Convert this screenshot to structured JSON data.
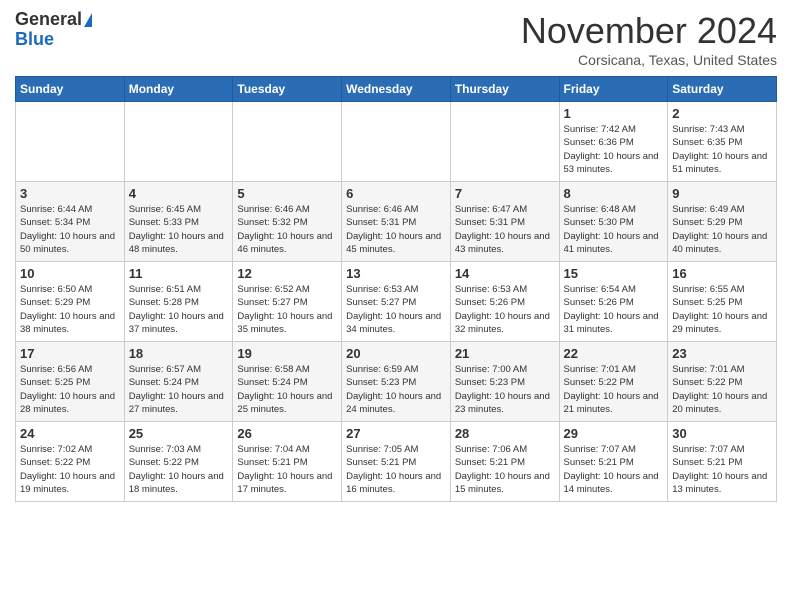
{
  "logo": {
    "general": "General",
    "blue": "Blue"
  },
  "header": {
    "month": "November 2024",
    "location": "Corsicana, Texas, United States"
  },
  "weekdays": [
    "Sunday",
    "Monday",
    "Tuesday",
    "Wednesday",
    "Thursday",
    "Friday",
    "Saturday"
  ],
  "weeks": [
    [
      {
        "day": "",
        "info": ""
      },
      {
        "day": "",
        "info": ""
      },
      {
        "day": "",
        "info": ""
      },
      {
        "day": "",
        "info": ""
      },
      {
        "day": "",
        "info": ""
      },
      {
        "day": "1",
        "info": "Sunrise: 7:42 AM\nSunset: 6:36 PM\nDaylight: 10 hours and 53 minutes."
      },
      {
        "day": "2",
        "info": "Sunrise: 7:43 AM\nSunset: 6:35 PM\nDaylight: 10 hours and 51 minutes."
      }
    ],
    [
      {
        "day": "3",
        "info": "Sunrise: 6:44 AM\nSunset: 5:34 PM\nDaylight: 10 hours and 50 minutes."
      },
      {
        "day": "4",
        "info": "Sunrise: 6:45 AM\nSunset: 5:33 PM\nDaylight: 10 hours and 48 minutes."
      },
      {
        "day": "5",
        "info": "Sunrise: 6:46 AM\nSunset: 5:32 PM\nDaylight: 10 hours and 46 minutes."
      },
      {
        "day": "6",
        "info": "Sunrise: 6:46 AM\nSunset: 5:31 PM\nDaylight: 10 hours and 45 minutes."
      },
      {
        "day": "7",
        "info": "Sunrise: 6:47 AM\nSunset: 5:31 PM\nDaylight: 10 hours and 43 minutes."
      },
      {
        "day": "8",
        "info": "Sunrise: 6:48 AM\nSunset: 5:30 PM\nDaylight: 10 hours and 41 minutes."
      },
      {
        "day": "9",
        "info": "Sunrise: 6:49 AM\nSunset: 5:29 PM\nDaylight: 10 hours and 40 minutes."
      }
    ],
    [
      {
        "day": "10",
        "info": "Sunrise: 6:50 AM\nSunset: 5:29 PM\nDaylight: 10 hours and 38 minutes."
      },
      {
        "day": "11",
        "info": "Sunrise: 6:51 AM\nSunset: 5:28 PM\nDaylight: 10 hours and 37 minutes."
      },
      {
        "day": "12",
        "info": "Sunrise: 6:52 AM\nSunset: 5:27 PM\nDaylight: 10 hours and 35 minutes."
      },
      {
        "day": "13",
        "info": "Sunrise: 6:53 AM\nSunset: 5:27 PM\nDaylight: 10 hours and 34 minutes."
      },
      {
        "day": "14",
        "info": "Sunrise: 6:53 AM\nSunset: 5:26 PM\nDaylight: 10 hours and 32 minutes."
      },
      {
        "day": "15",
        "info": "Sunrise: 6:54 AM\nSunset: 5:26 PM\nDaylight: 10 hours and 31 minutes."
      },
      {
        "day": "16",
        "info": "Sunrise: 6:55 AM\nSunset: 5:25 PM\nDaylight: 10 hours and 29 minutes."
      }
    ],
    [
      {
        "day": "17",
        "info": "Sunrise: 6:56 AM\nSunset: 5:25 PM\nDaylight: 10 hours and 28 minutes."
      },
      {
        "day": "18",
        "info": "Sunrise: 6:57 AM\nSunset: 5:24 PM\nDaylight: 10 hours and 27 minutes."
      },
      {
        "day": "19",
        "info": "Sunrise: 6:58 AM\nSunset: 5:24 PM\nDaylight: 10 hours and 25 minutes."
      },
      {
        "day": "20",
        "info": "Sunrise: 6:59 AM\nSunset: 5:23 PM\nDaylight: 10 hours and 24 minutes."
      },
      {
        "day": "21",
        "info": "Sunrise: 7:00 AM\nSunset: 5:23 PM\nDaylight: 10 hours and 23 minutes."
      },
      {
        "day": "22",
        "info": "Sunrise: 7:01 AM\nSunset: 5:22 PM\nDaylight: 10 hours and 21 minutes."
      },
      {
        "day": "23",
        "info": "Sunrise: 7:01 AM\nSunset: 5:22 PM\nDaylight: 10 hours and 20 minutes."
      }
    ],
    [
      {
        "day": "24",
        "info": "Sunrise: 7:02 AM\nSunset: 5:22 PM\nDaylight: 10 hours and 19 minutes."
      },
      {
        "day": "25",
        "info": "Sunrise: 7:03 AM\nSunset: 5:22 PM\nDaylight: 10 hours and 18 minutes."
      },
      {
        "day": "26",
        "info": "Sunrise: 7:04 AM\nSunset: 5:21 PM\nDaylight: 10 hours and 17 minutes."
      },
      {
        "day": "27",
        "info": "Sunrise: 7:05 AM\nSunset: 5:21 PM\nDaylight: 10 hours and 16 minutes."
      },
      {
        "day": "28",
        "info": "Sunrise: 7:06 AM\nSunset: 5:21 PM\nDaylight: 10 hours and 15 minutes."
      },
      {
        "day": "29",
        "info": "Sunrise: 7:07 AM\nSunset: 5:21 PM\nDaylight: 10 hours and 14 minutes."
      },
      {
        "day": "30",
        "info": "Sunrise: 7:07 AM\nSunset: 5:21 PM\nDaylight: 10 hours and 13 minutes."
      }
    ]
  ]
}
